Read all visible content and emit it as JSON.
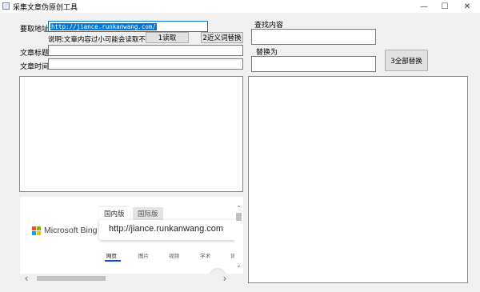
{
  "window": {
    "title": "采集文章伪原创工具",
    "minimize_glyph": "—",
    "maximize_glyph": "☐",
    "close_glyph": "✕"
  },
  "form": {
    "url_label": "要取地址",
    "url_value": "http://jiance.runkanwang.com/",
    "note": "说明:文章内容过小可能会读取不了..",
    "read_button": "1读取",
    "synonym_button": "2近义词替换",
    "title_label": "文章标题:",
    "title_value": "",
    "time_label": "文章时间:",
    "time_value": "",
    "find_label": "查找内容",
    "find_value": "",
    "replace_label": "替换为",
    "replace_value": "",
    "replace_all_button": "3全部替换"
  },
  "browser": {
    "logo_text": "Microsoft Bing",
    "logo_colors": [
      "#f25022",
      "#7fba00",
      "#00a4ef",
      "#ffb900"
    ],
    "tabs": [
      {
        "label": "国内版",
        "active": true
      },
      {
        "label": "国际版",
        "active": false
      }
    ],
    "search_text": "http://jiance.runkanwang.com",
    "nav_items": [
      "网页",
      "图片",
      "视频",
      "学术",
      "词"
    ],
    "accent": "#174ae4"
  },
  "scrollbars": {
    "up_arrow": "⌃",
    "down_arrow": "⌄",
    "left_arrow": "‹",
    "right_arrow": "›"
  }
}
